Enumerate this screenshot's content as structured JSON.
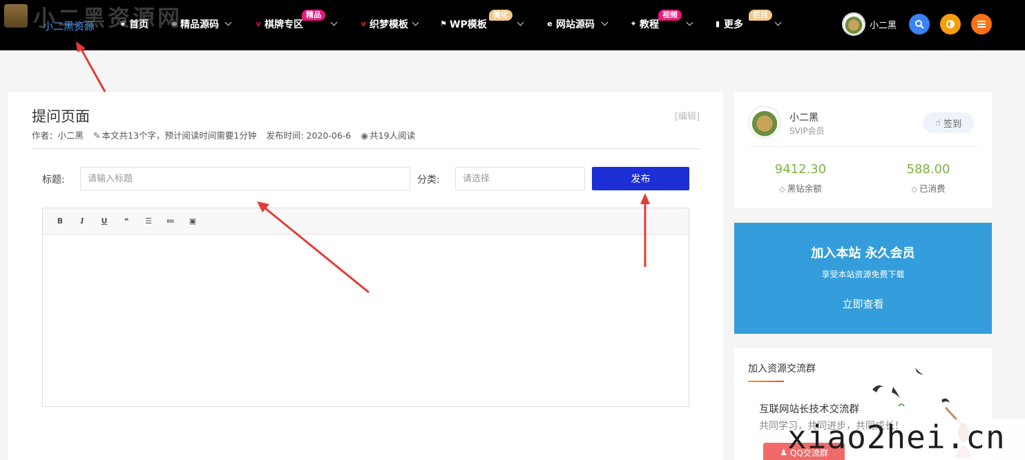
{
  "brand": {
    "watermark": "小二黑资源网",
    "site_name": "小二黑资源"
  },
  "nav": {
    "items": [
      {
        "label": "首页",
        "icon": "home-icon"
      },
      {
        "label": "精品源码",
        "icon": "code-icon"
      },
      {
        "label": "棋牌专区",
        "icon": "v-icon",
        "badge": "精品"
      },
      {
        "label": "织梦模板",
        "icon": "v-icon"
      },
      {
        "label": "WP模板",
        "icon": "wp-icon",
        "badge": "美化"
      },
      {
        "label": "网站源码",
        "icon": "ie-icon"
      },
      {
        "label": "教程",
        "icon": "star-icon",
        "badge": "视频"
      },
      {
        "label": "更多",
        "icon": "bookmark-icon",
        "badge": "栏目"
      }
    ],
    "username": "小二黑"
  },
  "article": {
    "title": "提问页面",
    "edit_label": "[编辑]",
    "author": "作者：小二黑",
    "word_count": "本文共13个字，预计阅读时间需要1分钟",
    "publish_time": "发布时间: 2020-06-6",
    "views": "共19人阅读"
  },
  "form": {
    "title_label": "标题:",
    "title_placeholder": "请输入标题",
    "category_label": "分类:",
    "category_placeholder": "请选择",
    "publish_label": "发布",
    "toolbar": [
      "B",
      "I",
      "U",
      "❝",
      "☰",
      "≔",
      "▣"
    ]
  },
  "user_card": {
    "name": "小二黑",
    "level": "SVIP会员",
    "signin_label": "签到",
    "balance_value": "9412.30",
    "balance_label": "黑钻余额",
    "spent_value": "588.00",
    "spent_label": "已消费"
  },
  "vip": {
    "title": "加入本站 永久会员",
    "subtitle": "享受本站资源免费下载",
    "button": "立即查看"
  },
  "group": {
    "title": "加入资源交流群",
    "line1": "互联网站长技术交流群",
    "line2": "共同学习，共同进步，共同成长！",
    "button": "QQ交流群"
  },
  "watermark_bottom": "xiao2hei.cn",
  "colors": {
    "publish": "#1c2fd4",
    "vip_bg": "#349ddb",
    "stat": "#7cb342",
    "arrow": "#e53935"
  }
}
